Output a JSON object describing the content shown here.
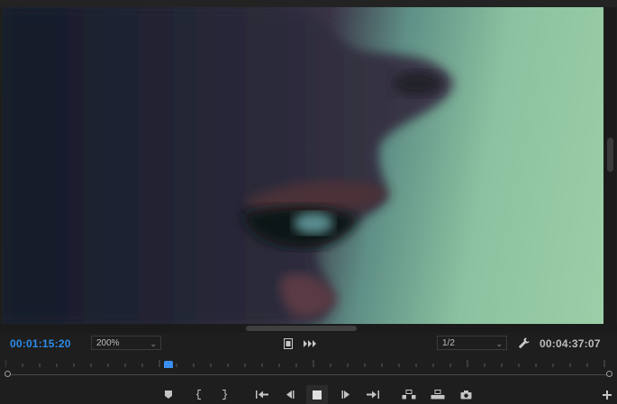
{
  "monitor": {
    "current_timecode": "00:01:15:20",
    "duration_timecode": "00:04:37:07",
    "zoom": {
      "selected": "200%"
    },
    "resolution": {
      "selected": "1/2"
    }
  },
  "icons": {
    "settings": "wrench-icon",
    "safe_margins": "film-icon",
    "insert_edit": "arrows-icon"
  },
  "colors": {
    "timecode_active": "#2d8ceb",
    "playhead": "#3b8ff0"
  },
  "playhead_position_fraction": 0.27
}
